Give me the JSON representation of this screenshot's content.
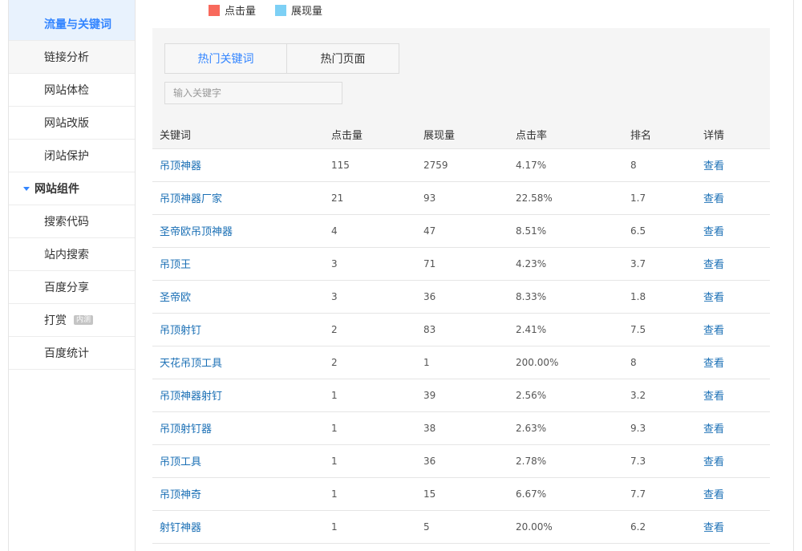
{
  "legend": [
    {
      "label": "点击量",
      "color": "#f8695c"
    },
    {
      "label": "展现量",
      "color": "#7dd0f5"
    }
  ],
  "sidebar": {
    "items": [
      {
        "label": "流量与关键词",
        "type": "item",
        "active": true
      },
      {
        "label": "链接分析",
        "type": "item"
      },
      {
        "label": "网站体检",
        "type": "item"
      },
      {
        "label": "网站改版",
        "type": "item"
      },
      {
        "label": "闭站保护",
        "type": "item"
      },
      {
        "label": "网站组件",
        "type": "group"
      },
      {
        "label": "搜索代码",
        "type": "item"
      },
      {
        "label": "站内搜索",
        "type": "item"
      },
      {
        "label": "百度分享",
        "type": "item"
      },
      {
        "label": "打赏",
        "type": "item",
        "badge": "内测"
      },
      {
        "label": "百度统计",
        "type": "item"
      }
    ]
  },
  "tabs": [
    {
      "label": "热门关键词",
      "active": true
    },
    {
      "label": "热门页面",
      "active": false
    }
  ],
  "search": {
    "placeholder": "输入关键字"
  },
  "table": {
    "headers": [
      "关键词",
      "点击量",
      "展现量",
      "点击率",
      "排名",
      "详情"
    ],
    "rows": [
      {
        "keyword": "吊顶神器",
        "clicks": "115",
        "impressions": "2759",
        "ctr": "4.17%",
        "rank": "8",
        "detail": "查看"
      },
      {
        "keyword": "吊顶神器厂家",
        "clicks": "21",
        "impressions": "93",
        "ctr": "22.58%",
        "rank": "1.7",
        "detail": "查看"
      },
      {
        "keyword": "圣帝欧吊顶神器",
        "clicks": "4",
        "impressions": "47",
        "ctr": "8.51%",
        "rank": "6.5",
        "detail": "查看"
      },
      {
        "keyword": "吊顶王",
        "clicks": "3",
        "impressions": "71",
        "ctr": "4.23%",
        "rank": "3.7",
        "detail": "查看"
      },
      {
        "keyword": "圣帝欧",
        "clicks": "3",
        "impressions": "36",
        "ctr": "8.33%",
        "rank": "1.8",
        "detail": "查看"
      },
      {
        "keyword": "吊顶射钉",
        "clicks": "2",
        "impressions": "83",
        "ctr": "2.41%",
        "rank": "7.5",
        "detail": "查看"
      },
      {
        "keyword": "天花吊顶工具",
        "clicks": "2",
        "impressions": "1",
        "ctr": "200.00%",
        "rank": "8",
        "detail": "查看"
      },
      {
        "keyword": "吊顶神器射钉",
        "clicks": "1",
        "impressions": "39",
        "ctr": "2.56%",
        "rank": "3.2",
        "detail": "查看"
      },
      {
        "keyword": "吊顶射钉器",
        "clicks": "1",
        "impressions": "38",
        "ctr": "2.63%",
        "rank": "9.3",
        "detail": "查看"
      },
      {
        "keyword": "吊顶工具",
        "clicks": "1",
        "impressions": "36",
        "ctr": "2.78%",
        "rank": "7.3",
        "detail": "查看"
      },
      {
        "keyword": "吊顶神奇",
        "clicks": "1",
        "impressions": "15",
        "ctr": "6.67%",
        "rank": "7.7",
        "detail": "查看"
      },
      {
        "keyword": "射钉神器",
        "clicks": "1",
        "impressions": "5",
        "ctr": "20.00%",
        "rank": "6.2",
        "detail": "查看"
      }
    ]
  }
}
